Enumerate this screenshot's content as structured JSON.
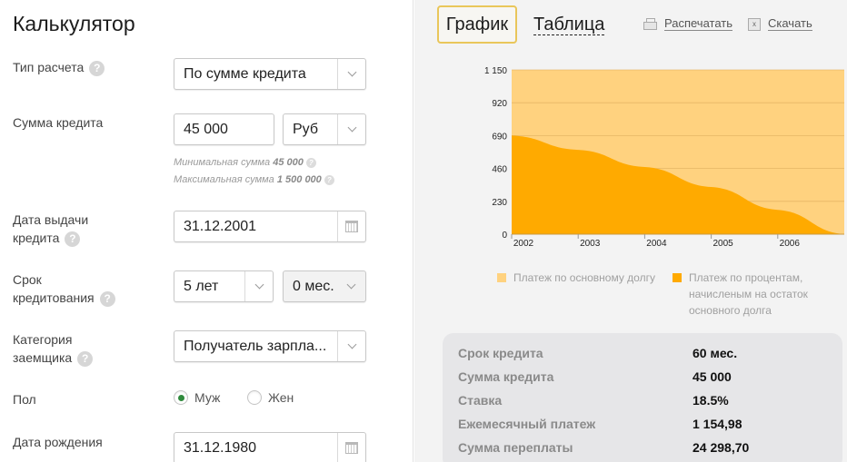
{
  "left": {
    "title": "Калькулятор",
    "calc_type": {
      "label": "Тип расчета",
      "value": "По сумме кредита"
    },
    "amount": {
      "label": "Сумма кредита",
      "value": "45 000",
      "currency": "Руб",
      "min_text": "Минимальная сумма",
      "min_value": "45 000",
      "max_text": "Максимальная сумма",
      "max_value": "1 500 000"
    },
    "issue_date": {
      "label_line1": "Дата выдачи",
      "label_line2": "кредита",
      "value": "31.12.2001"
    },
    "term": {
      "label_line1": "Срок",
      "label_line2": "кредитования",
      "years": "5 лет",
      "months": "0 мес."
    },
    "category": {
      "label_line1": "Категория",
      "label_line2": "заемщика",
      "value": "Получатель зарпла..."
    },
    "gender": {
      "label": "Пол",
      "options": [
        "Муж",
        "Жен"
      ],
      "selected": "Муж"
    },
    "birth_date": {
      "label": "Дата рождения",
      "value": "31.12.1980"
    },
    "help_glyph": "?"
  },
  "right": {
    "tabs": [
      {
        "label": "График",
        "active": true
      },
      {
        "label": "Таблица",
        "active": false
      }
    ],
    "actions": {
      "print": "Распечатать",
      "download": "Скачать",
      "xls_glyph": "x"
    },
    "legend": {
      "principal": "Платеж по основному долгу",
      "interest_line1": "Платеж по процентам,",
      "interest_line2": "начисленым на остаток",
      "interest_line3": "основного долга"
    },
    "summary": [
      {
        "label": "Срок кредита",
        "value": "60 мес."
      },
      {
        "label": "Сумма кредита",
        "value": "45 000"
      },
      {
        "label": "Ставка",
        "value": "18.5%"
      },
      {
        "label": "Ежемесячный платеж",
        "value": "1 154,98"
      },
      {
        "label": "Сумма переплаты",
        "value": "24 298,70"
      }
    ]
  },
  "chart_data": {
    "type": "area",
    "title": "",
    "xlabel": "",
    "ylabel": "",
    "ylim": [
      0,
      1150
    ],
    "xlim": [
      2002,
      2007
    ],
    "yticks": [
      0,
      230,
      460,
      690,
      920,
      1150
    ],
    "ytick_labels": [
      "0",
      "230",
      "460",
      "690",
      "920",
      "1 150"
    ],
    "xticks": [
      2002,
      2003,
      2004,
      2005,
      2006
    ],
    "xtick_labels": [
      "2002",
      "2003",
      "2004",
      "2005",
      "2006"
    ],
    "grid": true,
    "stacked": true,
    "x": [
      2002,
      2003,
      2004,
      2005,
      2006,
      2007
    ],
    "series": [
      {
        "name": "Платеж по процентам, начисленым на остаток основного долга",
        "color": "#ffaa00",
        "values": [
          690,
          590,
          470,
          330,
          170,
          0
        ]
      },
      {
        "name": "Платеж по основному долгу",
        "color": "#ffd27f",
        "values": [
          460,
          560,
          680,
          820,
          980,
          1150
        ]
      }
    ],
    "legend_position": "bottom"
  }
}
